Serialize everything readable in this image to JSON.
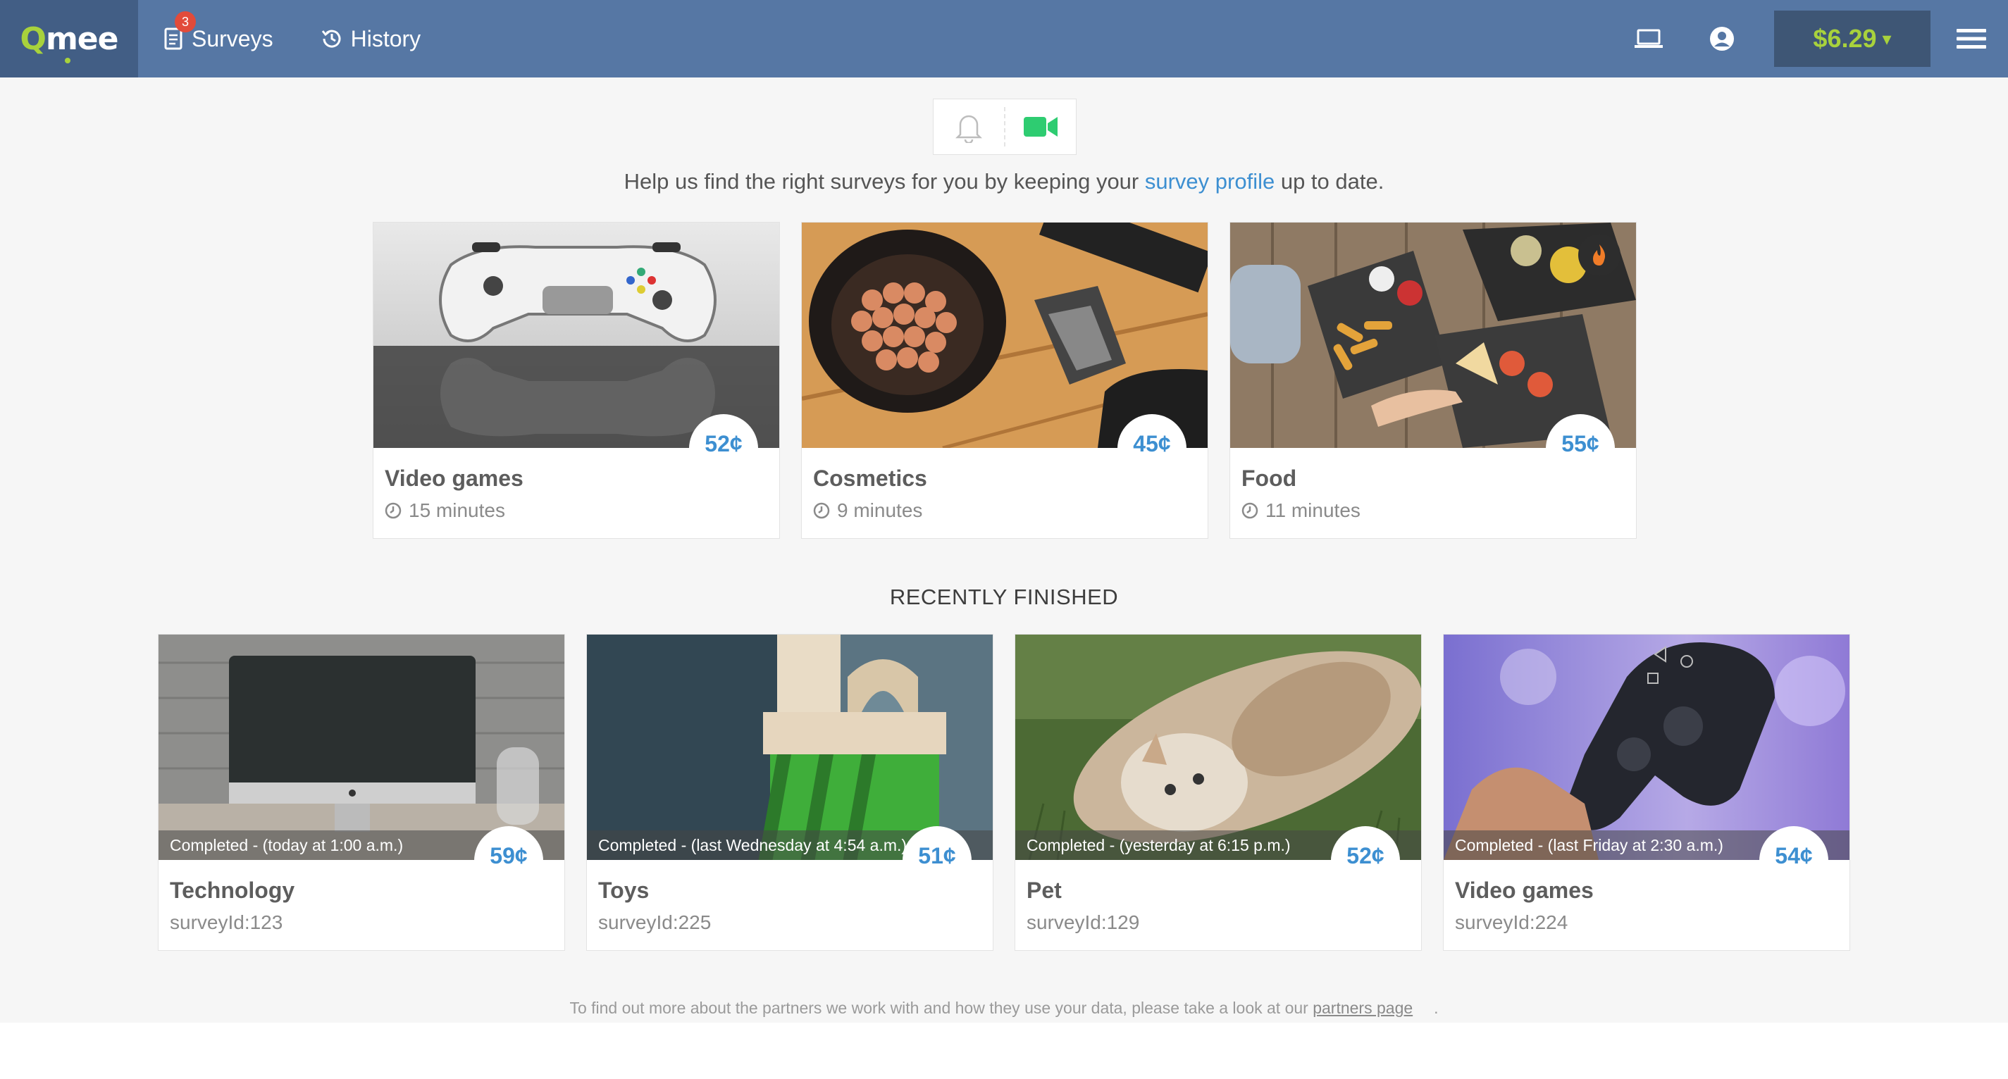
{
  "nav": {
    "brand_q": "Q",
    "brand_rest": "mee",
    "surveys_label": "Surveys",
    "surveys_badge": "3",
    "history_label": "History",
    "balance": "$6.29",
    "balance_caret": "▾",
    "icons": [
      "survey-list-icon",
      "history-icon",
      "laptop-icon",
      "account-icon",
      "menu-icon"
    ]
  },
  "notify": {
    "icons": [
      "bell-icon",
      "video-camera-icon"
    ],
    "accent_color": "#2ecc71"
  },
  "help": {
    "before": "Help us find the right surveys for you by keeping your ",
    "link": "survey profile",
    "after": " up to date."
  },
  "available": [
    {
      "title": "Video games",
      "price": "52¢",
      "duration": "15 minutes"
    },
    {
      "title": "Cosmetics",
      "price": "45¢",
      "duration": "9 minutes"
    },
    {
      "title": "Food",
      "price": "55¢",
      "duration": "11 minutes"
    }
  ],
  "recent_title": "RECENTLY FINISHED",
  "recent": [
    {
      "title": "Technology",
      "price": "59¢",
      "status": "Completed - (today at 1:00 a.m.)",
      "survey_id": "surveyId:123"
    },
    {
      "title": "Toys",
      "price": "51¢",
      "status": "Completed - (last Wednesday at 4:54 a.m.)",
      "survey_id": "surveyId:225"
    },
    {
      "title": "Pet",
      "price": "52¢",
      "status": "Completed - (yesterday at 6:15 p.m.)",
      "survey_id": "surveyId:129"
    },
    {
      "title": "Video games",
      "price": "54¢",
      "status": "Completed - (last Friday at 2:30 a.m.)",
      "survey_id": "surveyId:224"
    }
  ],
  "footer": {
    "text": "To find out more about the partners we work with and how they use your data, please take a look at our ",
    "link": "partners page",
    "end": "."
  },
  "colors": {
    "nav_bg": "#5677a4",
    "brand_bg": "#425e85",
    "accent_green": "#a8d23c",
    "price_blue": "#3d8fd1"
  }
}
